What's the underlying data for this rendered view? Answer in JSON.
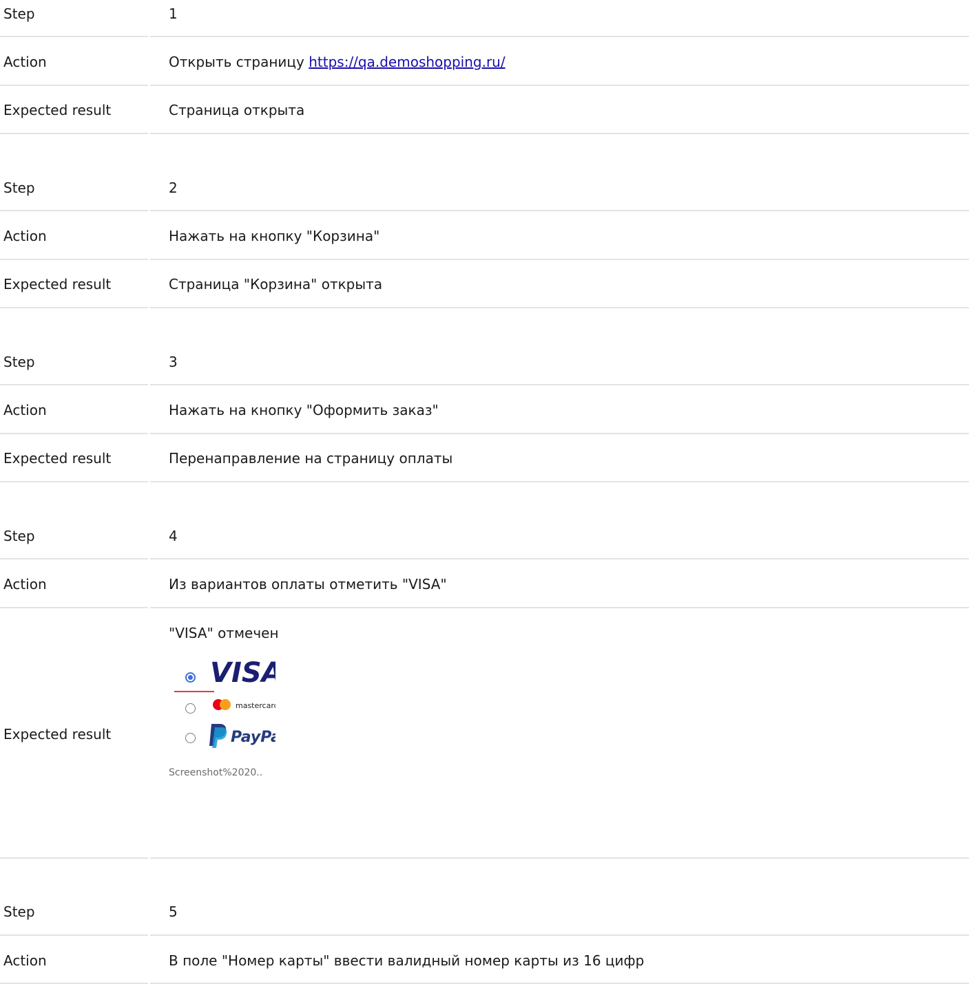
{
  "labels": {
    "step": "Step",
    "action": "Action",
    "expected": "Expected result"
  },
  "steps": [
    {
      "step": "1",
      "action": "Открыть страницу ",
      "action_link": "https://qa.demoshopping.ru/",
      "expected": "Страница открыта"
    },
    {
      "step": "2",
      "action": "Нажать на кнопку \"Корзина\"",
      "expected": "Страница \"Корзина\" открыта"
    },
    {
      "step": "3",
      "action": "Нажать на кнопку \"Оформить заказ\"",
      "expected": "Перенаправление на страницу оплаты"
    },
    {
      "step": "4",
      "action": "Из вариантов оплаты отметить \"VISA\"",
      "expected": "\"VISA\" отмечен",
      "attachment": {
        "caption": "Screenshot%2020..",
        "options": [
          {
            "brand": "VISA",
            "selected": true
          },
          {
            "brand": "mastercard",
            "selected": false
          },
          {
            "brand": "PayPal",
            "selected": false
          }
        ]
      }
    },
    {
      "step": "5",
      "action": "В поле \"Номер карты\" ввести валидный номер карты из 16 цифр"
    }
  ],
  "colors": {
    "link": "#1a0dab",
    "divider": "#e3e3e3",
    "radio_selected": "#3b6fd8",
    "visa_blue": "#1a1f71",
    "paypal_dark": "#253b80",
    "paypal_light": "#179bd7",
    "mastercard_red": "#eb001b",
    "mastercard_orange": "#f79e1b",
    "underline_red": "#e53935"
  }
}
